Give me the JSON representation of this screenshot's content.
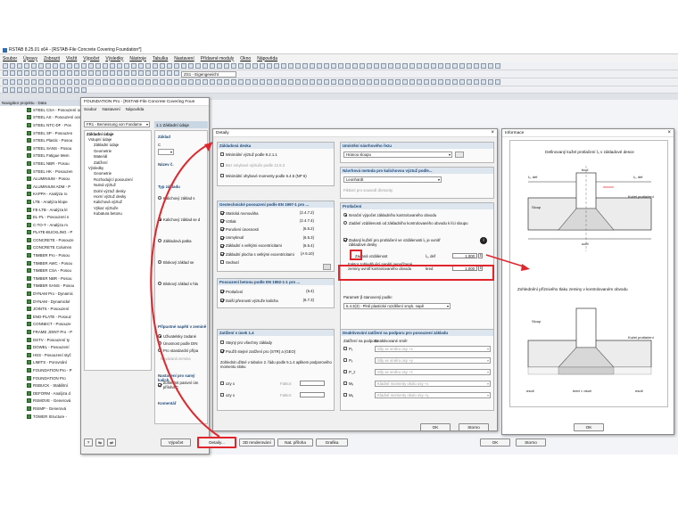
{
  "app": {
    "title": "RSTAB 8.25.01 x64 - [RSTAB-File Concrete Covering Foundation*]",
    "menu": [
      "Soubor",
      "Úpravy",
      "Zobrazit",
      "Vložit",
      "Výpočet",
      "Výsledky",
      "Nástroje",
      "Tabulka",
      "Nastavení",
      "Přídavné moduly",
      "Okno",
      "Nápověda"
    ],
    "loadcase_combo": "ZS1 - Eigengewicht"
  },
  "navigator": {
    "title": "Navigátor projektu - Data",
    "items": [
      "STEEL CSA - Posouzení ocelových pru",
      "STEEL AS - Posouzení ocelových prv",
      "STEEL NTC-DF - Pos",
      "STEEL SP - Posouzen",
      "STEEL Plastic - Posou",
      "STEEL SANS - Posou",
      "STEEL Fatigue Mem",
      "STEEL NBR - Posou",
      "STEEL HK - Posouzen",
      "ALUMINIUM - Posou",
      "ALUMINIUM ADM - P",
      "KAPPA - Analýza ro",
      "LTB - Analýza klope",
      "FE-LTB - Analýza kl",
      "EL-PL - Posouzení n",
      "C-TO-T - Analýza m",
      "PLATE-BUCKLING - P",
      "CONCRETE - Posouze",
      "CONCRETE Columns",
      "TIMBER Pro - Posou",
      "TIMBER AWC - Posou",
      "TIMBER CSA - Posou",
      "TIMBER NBR - Posou",
      "TIMBER SANS - Posou",
      "DYNAM Pro - Dynamic",
      "DYNAM - Dynamické",
      "JOINTS - Posouzení",
      "END-PLATE - Posouz",
      "CONNECT - Posouze",
      "FRAME JOINT Pro - P",
      "DSTV - Posouzení ty",
      "DOWEL - Posouzení",
      "HSS - Posouzení styč",
      "LIMITS - Porovnání",
      "FOUNDATION Pro - P",
      "FOUNDATION Pro",
      "RSBUCK - Stabilitní",
      "DEFORM - Analýza d",
      "RSMOVE - Generová",
      "RSIMP - Generová",
      "TOWER Structure -"
    ]
  },
  "foundation_window": {
    "title": "FOUNDATION Pro - [RSTAB-File Concrete Covering Foun",
    "menu": [
      "Soubor",
      "Nastavení",
      "Nápověda"
    ],
    "case": "FR1 - Bemessung von Fundame",
    "tree_head": "Základní údaje",
    "tree": [
      "Vstupní údaje",
      "Základní údaje",
      "Geometrie",
      "Materiál",
      "Zatížení",
      "Výsledky",
      "Geometrie",
      "Rozhodující posouzení",
      "Nutná výztuž",
      "Dolní výztuž desky",
      "Horní výztuž desky",
      "Kalichová výztuž",
      "Výkaz výztuže",
      "Kubatura betonu"
    ],
    "section_head": "1.1 Základní údaje",
    "zaklad_label": "Základ",
    "c_label": "C",
    "nazev_label": "Název č.",
    "typ_label": "Typ základu",
    "types": [
      "Kalichový základ s",
      "Kalichový základ se d",
      "Základová patka",
      "Blokový základ se",
      "Blokový základ s hla"
    ],
    "pripustne_label": "Přípustné napětí v zemině",
    "pripustne_opts": [
      "Uživatelsky zadané",
      "Únosnost podle DIN",
      "Pro standardní přípa"
    ],
    "nevazana": "Nevázaná zemina",
    "nastaveni_label": "Nastavení pro samý kalich",
    "zohlednit": "Zohlednit pasivní úm příloha C",
    "komentar_label": "Komentář",
    "buttons": {
      "vypocet": "Výpočet",
      "detaily": "Detaily...",
      "render": "3D renderování",
      "nat": "Nat. příloha",
      "grafika": "Grafika",
      "ok": "OK",
      "storno": "Storno"
    }
  },
  "details": {
    "title": "Detaily",
    "g1": {
      "title": "Základová deska",
      "items": [
        "Minimální výztuž podle 9.2.1.1",
        "Bez smykové výztuže podle 12.9.3",
        "Minimální ohybové momenty podle 6.4.5 (NP 6)"
      ]
    },
    "g2": {
      "title": "Geotechnické posouzení podle EN 1997-1 pro ...",
      "items": [
        "Statická rovnováha",
        "Vztlak",
        "Porušení únosnosti",
        "Usmyknutí",
        "Základní s velkými excentricitami",
        "Základní plocha s velkými excentricitami",
        "Sednutí"
      ],
      "refs": [
        "(2.4.7.2)",
        "(2.4.7.4)",
        "(6.5.2)",
        "(6.5.3)",
        "(6.5.4)",
        "(A 6.10)",
        ""
      ]
    },
    "g3": {
      "title": "Posouzení betonu podle EN 1992-1-1 pro ...",
      "items": [
        "Protlačení",
        "Další přesnosti výztuže kalicha"
      ],
      "refs": [
        "(6.4)",
        "(6.7.3)"
      ]
    },
    "g4": {
      "title": "Zatížení v úsek 1.4",
      "items": [
        "Stejný pro všechny základy",
        "Použít stejné zatížení pro (STR) a (GEO)"
      ],
      "note": "Zohlednit užitné v tabulce 2. řádu podle 5.1.4 aplikem podporového momentu sloku",
      "sub": [
        "ozy x",
        "ozy x"
      ],
      "sublabels": [
        "Faktor:",
        "Faktor:"
      ]
    },
    "g5": {
      "title": "Umístění návrhového řezu",
      "value": "Hranou sloupu"
    },
    "g6": {
      "title": "Návrhová metoda pro kalichovou výztuž podle...",
      "value": "Leonhardt",
      "extra": "Fiktivní pro sousedí ďemonty"
    },
    "g7": {
      "title": "Protlačení",
      "items": [
        "Iterační výpočet základního kontrolovaného obvodu",
        "Zadání vzdálenosti od základního kontrolovaného obvodu k líci sloupu",
        "Zadaný kuželí pro protlačení ve vzdálenosti l₀ je uvnitř základové desky"
      ],
      "zad_label": "Zadaná vzdálenost",
      "zad_sym": "l₀, def",
      "zad_val": "1.000",
      "faktor_label": "Faktor zohledňující napětí nepořízené zeminy uvnitř kontrolovaného obvodu",
      "faktor_sym": "kred",
      "faktor_val": "1.000",
      "param_label": "Parametr β stanovený podle:",
      "param_val": "6.4.3(3) - Plně plastické rozdělení smyk. napě"
    },
    "g8": {
      "title": "Deaktivování zatížení na podporu pro posouzení základu",
      "col1": "Zatížení na podporu",
      "col2": "Deaktivované směr",
      "rows": [
        {
          "n": "Pₓ",
          "v": "Síly ve směru osy +x"
        },
        {
          "n": "Pᵧ",
          "v": "Síly ve směru osy +y"
        },
        {
          "n": "P_z",
          "v": "Síly ve směru osy +z"
        },
        {
          "n": "Mₓ",
          "v": "Kladné momenty okolo osy +x"
        },
        {
          "n": "Mᵧ",
          "v": "Kladné momenty okolo osy +y"
        }
      ]
    },
    "buttons": {
      "ok": "OK",
      "storno": "Storno"
    }
  },
  "info": {
    "title": "Informace",
    "caption1": "Definovaný kužel protlačení l₀ v základové desce",
    "lbl_l0def_left": "l₀, def",
    "lbl_l0def_right": "l₀, def",
    "lbl_bcol": "bcol",
    "lbl_kuzel": "Kužel protlačení",
    "lbl_sloup": "Sloup",
    "lbl_ucrit": "ucrit",
    "caption2": "Zohlednění příznivého tlaku zeminy v kontrolovaném obvodu",
    "lbl_sloup2": "Sloup",
    "lbl_kuzel2": "Kužel protlačení",
    "lbl_bot1": "σsoil",
    "lbl_bot2": "kred × σsoil",
    "lbl_bot3": "σsoil",
    "ok": "OK"
  }
}
